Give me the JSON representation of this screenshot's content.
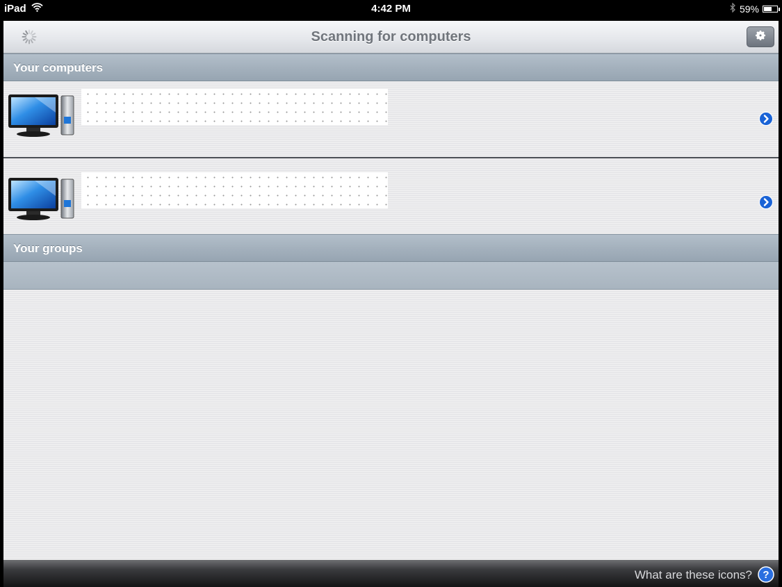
{
  "status_bar": {
    "device": "iPad",
    "time": "4:42 PM",
    "battery_label": "59%",
    "battery_level": 0.59,
    "icons": [
      "wifi-icon",
      "bluetooth-icon",
      "battery-icon"
    ]
  },
  "nav": {
    "title": "Scanning for computers",
    "icons": [
      "activity-spinner-icon",
      "gear-icon"
    ]
  },
  "sections": {
    "computers": {
      "header": "Your computers",
      "rows": [
        {
          "icon": "desktop-computer-icon",
          "name": "",
          "accessory": "disclosure-chevron-icon"
        },
        {
          "icon": "desktop-computer-icon",
          "name": "",
          "accessory": "disclosure-chevron-icon"
        }
      ]
    },
    "groups": {
      "header": "Your groups",
      "rows": []
    }
  },
  "footer": {
    "help_text": "What are these icons?",
    "icon": "help-question-icon"
  },
  "colors": {
    "section_header": "#a4b1bd",
    "accent_blue": "#1a63d6",
    "nav_title": "#70757c",
    "background": "#eeeeef"
  }
}
